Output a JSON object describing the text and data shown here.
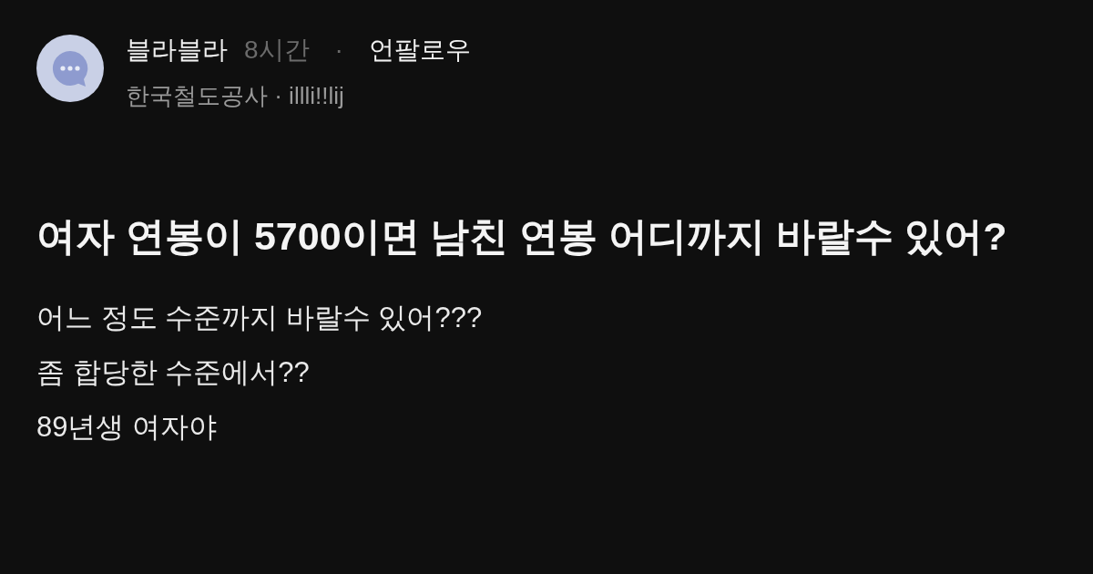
{
  "post": {
    "board": "블라블라",
    "time": "8시간",
    "separator": "·",
    "follow_button": "언팔로우",
    "author_meta": "한국철도공사 · illli!!lij",
    "title": "여자 연봉이 5700이면 남친 연봉 어디까지 바랄수 있어?",
    "body_lines": [
      "어느 정도 수준까지 바랄수 있어???",
      "좀 합당한 수준에서??",
      "89년생 여자야"
    ]
  }
}
